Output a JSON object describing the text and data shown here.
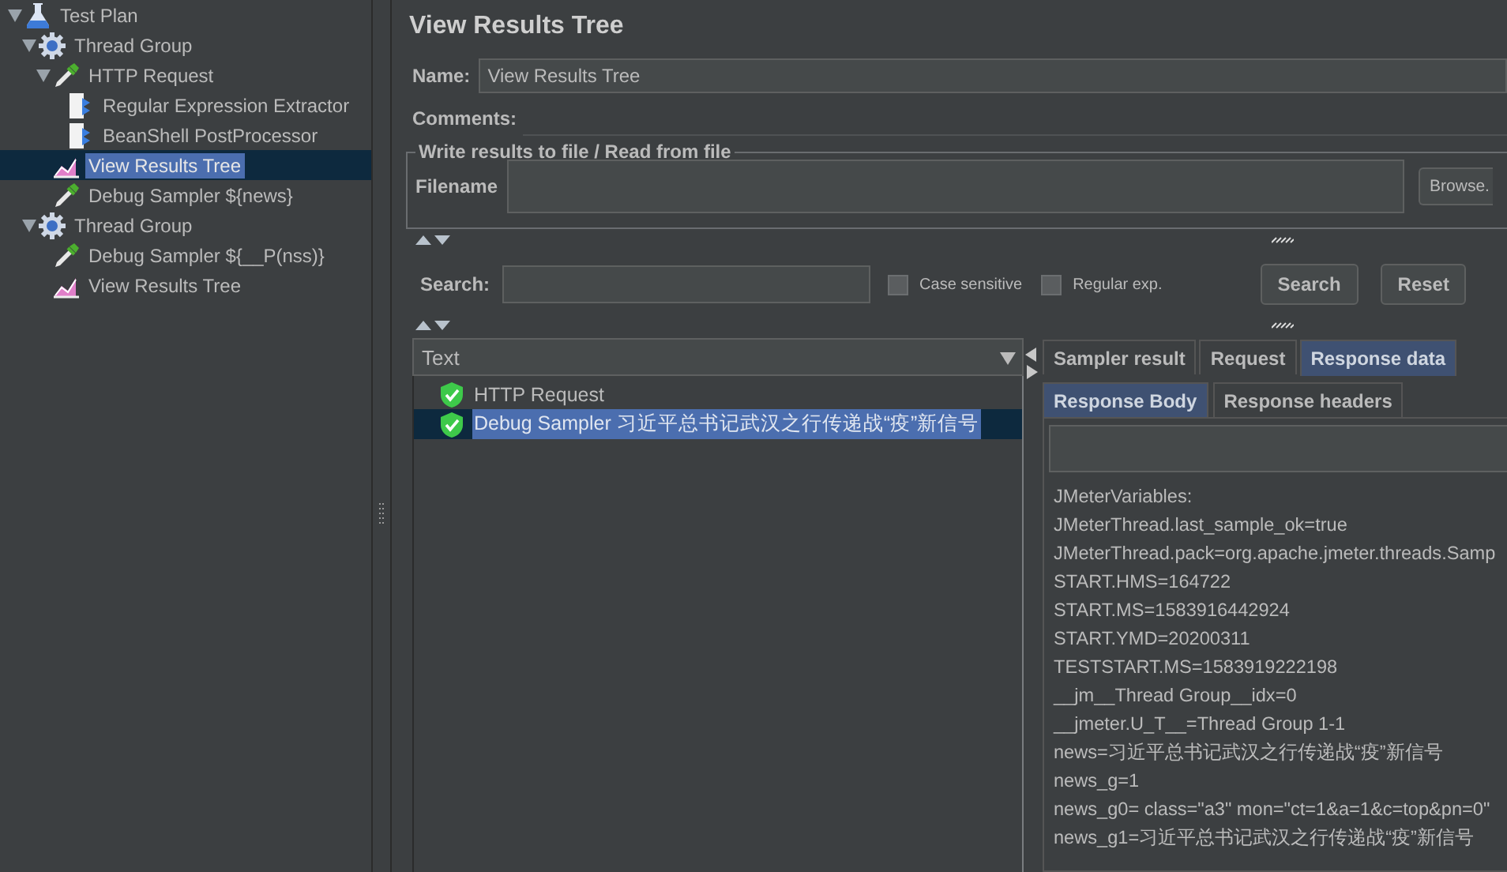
{
  "tree": [
    {
      "label": "Test Plan",
      "kind": "plan",
      "expanded": true,
      "selected": false,
      "children": [
        {
          "label": "Thread Group",
          "kind": "group",
          "expanded": true,
          "selected": false,
          "children": [
            {
              "label": "HTTP Request",
              "kind": "sampler",
              "expanded": true,
              "selected": false,
              "children": [
                {
                  "label": "Regular Expression Extractor",
                  "kind": "processor",
                  "selected": false
                },
                {
                  "label": "BeanShell PostProcessor",
                  "kind": "processor",
                  "selected": false
                }
              ]
            },
            {
              "label": "View Results Tree",
              "kind": "listener",
              "selected": true
            },
            {
              "label": "Debug Sampler ${news}",
              "kind": "sampler",
              "selected": false
            }
          ]
        },
        {
          "label": "Thread Group",
          "kind": "group",
          "expanded": true,
          "selected": false,
          "children": [
            {
              "label": "Debug Sampler ${__P(nss)}",
              "kind": "sampler",
              "selected": false
            },
            {
              "label": "View Results Tree",
              "kind": "listener",
              "selected": false
            }
          ]
        }
      ]
    }
  ],
  "editor": {
    "title": "View Results Tree",
    "name_label": "Name:",
    "name_value": "View Results Tree",
    "comments_label": "Comments:",
    "file_group": {
      "legend": "Write results to file / Read from file",
      "label": "Filename",
      "button": "Browse."
    }
  },
  "search": {
    "label": "Search:",
    "options": [
      {
        "label": "Case sensitive",
        "checked": false
      },
      {
        "label": "Regular exp.",
        "checked": false
      }
    ],
    "buttons": [
      "Search",
      "Reset"
    ]
  },
  "results": {
    "column": "Text",
    "rows": [
      {
        "label": "HTTP Request",
        "selected": false
      },
      {
        "label": "Debug Sampler 习近平总书记武汉之行传递战“疫”新信号",
        "selected": true
      }
    ]
  },
  "tabs": [
    {
      "label": "Sampler result",
      "selected": false
    },
    {
      "label": "Request",
      "selected": false
    },
    {
      "label": "Response data",
      "selected": true
    }
  ],
  "subtabs": [
    {
      "label": "Response Body",
      "selected": true
    },
    {
      "label": "Response headers",
      "selected": false
    }
  ],
  "response_lines": [
    "JMeterVariables:",
    "JMeterThread.last_sample_ok=true",
    "JMeterThread.pack=org.apache.jmeter.threads.Samp",
    "START.HMS=164722",
    "START.MS=1583916442924",
    "START.YMD=20200311",
    "TESTSTART.MS=1583919222198",
    "__jm__Thread Group__idx=0",
    "__jmeter.U_T__=Thread Group 1-1",
    "news=习近平总书记武汉之行传递战“疫”新信号",
    "news_g=1",
    "news_g0= class=\"a3\" mon=\"ct=1&a=1&c=top&pn=0\"",
    "news_g1=习近平总书记武汉之行传递战“疫”新信号"
  ]
}
